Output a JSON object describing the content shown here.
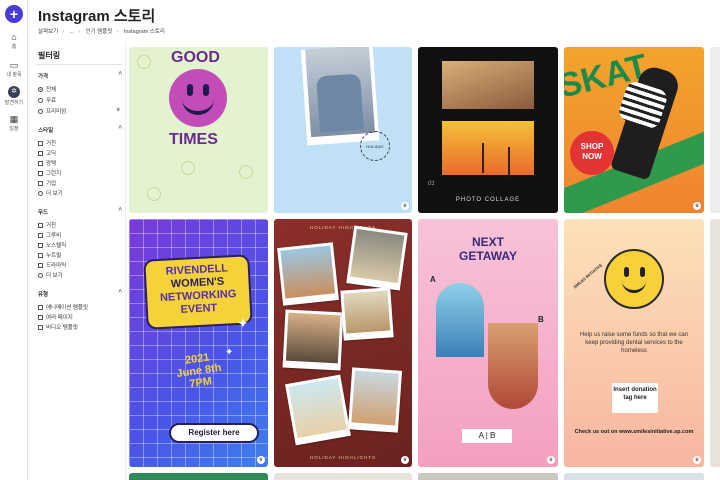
{
  "rail": {
    "items": [
      {
        "icon": "home-icon",
        "glyph": "⌂",
        "label": "홈"
      },
      {
        "icon": "folder-icon",
        "glyph": "▭",
        "label": "내 항목"
      },
      {
        "icon": "compass-icon",
        "glyph": "✲",
        "label": "발견하기"
      },
      {
        "icon": "calendar-icon",
        "glyph": "▦",
        "label": "일정"
      }
    ],
    "active_index": 2,
    "create_glyph": "+"
  },
  "header": {
    "title": "Instagram 스토리",
    "breadcrumb": [
      "살펴보기",
      "...",
      "인기 템플릿",
      "Instagram 스토리"
    ]
  },
  "filters": {
    "title": "필터링",
    "sections": {
      "price": {
        "label": "가격",
        "options": [
          "전체",
          "무료",
          "프리미엄"
        ],
        "selected": "전체"
      },
      "style": {
        "label": "스타일",
        "options": [
          "거친",
          "고딕",
          "광택",
          "그런지",
          "기업",
          "더 보기"
        ]
      },
      "mood": {
        "label": "무드",
        "options": [
          "거친",
          "그루비",
          "노스탤직",
          "누트럴",
          "드라마틱",
          "더 보기"
        ]
      },
      "type": {
        "label": "유형",
        "options": [
          "애니메이션 템플릿",
          "여러 페이지",
          "비디오 템플릿"
        ]
      }
    }
  },
  "templates": {
    "t1": {
      "words": [
        "GOOD",
        "TIMES"
      ]
    },
    "t2": {
      "stamp": "HOLIDAY"
    },
    "t3": {
      "caption": "PHOTO COLLAGE",
      "tag": "01"
    },
    "t4": {
      "headline": "SKAT",
      "badge": [
        "SHOP",
        "NOW"
      ]
    },
    "t5": {
      "lines": [
        "RIVENDELL",
        "WOMEN'S",
        "NETWORKING",
        "EVENT"
      ],
      "date": [
        "2021",
        "June 8th",
        "7PM"
      ],
      "button": "Register here"
    },
    "t6": {
      "header": "HOLIDAY HIGHLIGHTS",
      "footer": "HOLIDAY HIGHLIGHTS"
    },
    "t7": {
      "title": [
        "NEXT",
        "GETAWAY"
      ],
      "label_a": "A",
      "label_b": "B",
      "choice": "A | B"
    },
    "t8": {
      "ring": "SMILES INITIATIVE",
      "body": "Help us raise some funds so that we can keep providing dental services to the homeless",
      "insert": "Insert donation tag here",
      "check": "Check us out on www.smilesinitiative.sp.com"
    }
  },
  "colors": {
    "accent": "#4a3bd8",
    "rail_active": "#3b3e56"
  }
}
